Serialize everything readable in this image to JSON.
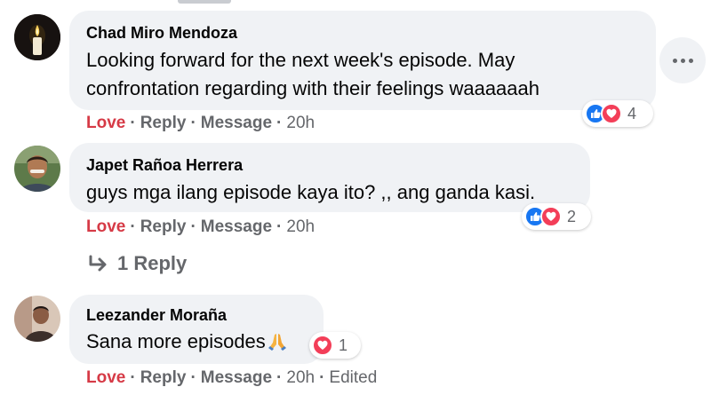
{
  "colors": {
    "love": "#d63a46",
    "like_reaction": "#1877f2",
    "love_reaction": "#f33e58",
    "bubble": "#f0f2f5",
    "meta": "#65676b"
  },
  "icons": {
    "more": "more-horizontal-icon",
    "reply_arrow": "reply-arrow-icon",
    "like": "like-reaction-icon",
    "heart": "love-reaction-icon",
    "pray": "folded-hands-emoji"
  },
  "comments": [
    {
      "author": "Chad Miro Mendoza",
      "lines": [
        "Looking forward for the next week's episode. May",
        "confrontation regarding with their feelings waaaaaah"
      ],
      "actions": {
        "love": "Love",
        "reply": "Reply",
        "message": "Message",
        "time": "20h"
      },
      "reactions": {
        "count": "4"
      }
    },
    {
      "author": "Japet Rañoa Herrera",
      "lines": [
        "guys mga ilang episode kaya ito? ,, ang ganda kasi."
      ],
      "actions": {
        "love": "Love",
        "reply": "Reply",
        "message": "Message",
        "time": "20h"
      },
      "reactions": {
        "count": "2"
      },
      "replies_label": "1 Reply"
    },
    {
      "author": "Leezander Moraña",
      "lines": [
        "Sana more episodes"
      ],
      "actions": {
        "love": "Love",
        "reply": "Reply",
        "message": "Message",
        "time": "20h",
        "edited": "Edited"
      },
      "reactions": {
        "count": "1"
      }
    }
  ]
}
